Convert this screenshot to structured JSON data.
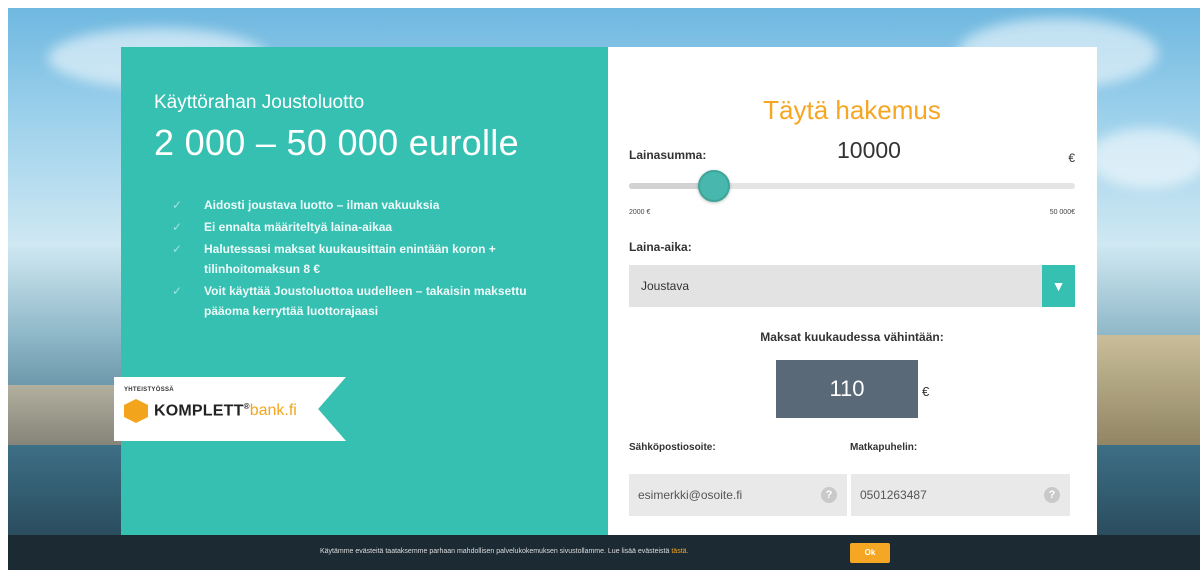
{
  "hero": {
    "subtitle": "Käyttörahan Joustoluotto",
    "headline": "2 000 – 50 000 eurolle",
    "features": [
      "Aidosti joustava luotto – ilman vakuuksia",
      "Ei ennalta määriteltyä laina-aikaa",
      "Halutessasi maksat kuukausittain enintään koron + tilinhoitomaksun 8 €",
      "Voit käyttää Joustoluottoa uudelleen – takaisin maksettu pääoma kerryttää luottorajaasi"
    ]
  },
  "partner": {
    "caption": "YHTEISTYÖSSÄ",
    "brand": "KOMPLETT",
    "registered": "®",
    "domain": "bank.fi"
  },
  "form": {
    "title": "Täytä hakemus",
    "amount_label": "Lainasumma:",
    "amount_value": "10000",
    "amount_currency": "€",
    "slider": {
      "min_label": "2000 €",
      "max_label": "50 000€",
      "min": 2000,
      "max": 50000,
      "value": 10000
    },
    "term_label": "Laina-aika:",
    "term_value": "Joustava",
    "monthly_label": "Maksat kuukaudessa vähintään:",
    "monthly_value": "110",
    "monthly_currency": "€",
    "email_label": "Sähköpostiosoite:",
    "email_placeholder": "esimerkki@osoite.fi",
    "phone_label": "Matkapuhelin:",
    "phone_placeholder": "0501263487",
    "help_glyph": "?"
  },
  "cookie": {
    "text": "Käytämme evästeitä taataksemme parhaan mahdollisen palvelukokemuksen sivustollamme. Lue lisää evästeistä",
    "link": "tästä.",
    "ok_label": "Ok"
  },
  "colors": {
    "teal": "#35c0b2",
    "orange": "#f5a623",
    "slate": "#5a6977",
    "cookie_bg": "#1c2a34"
  }
}
